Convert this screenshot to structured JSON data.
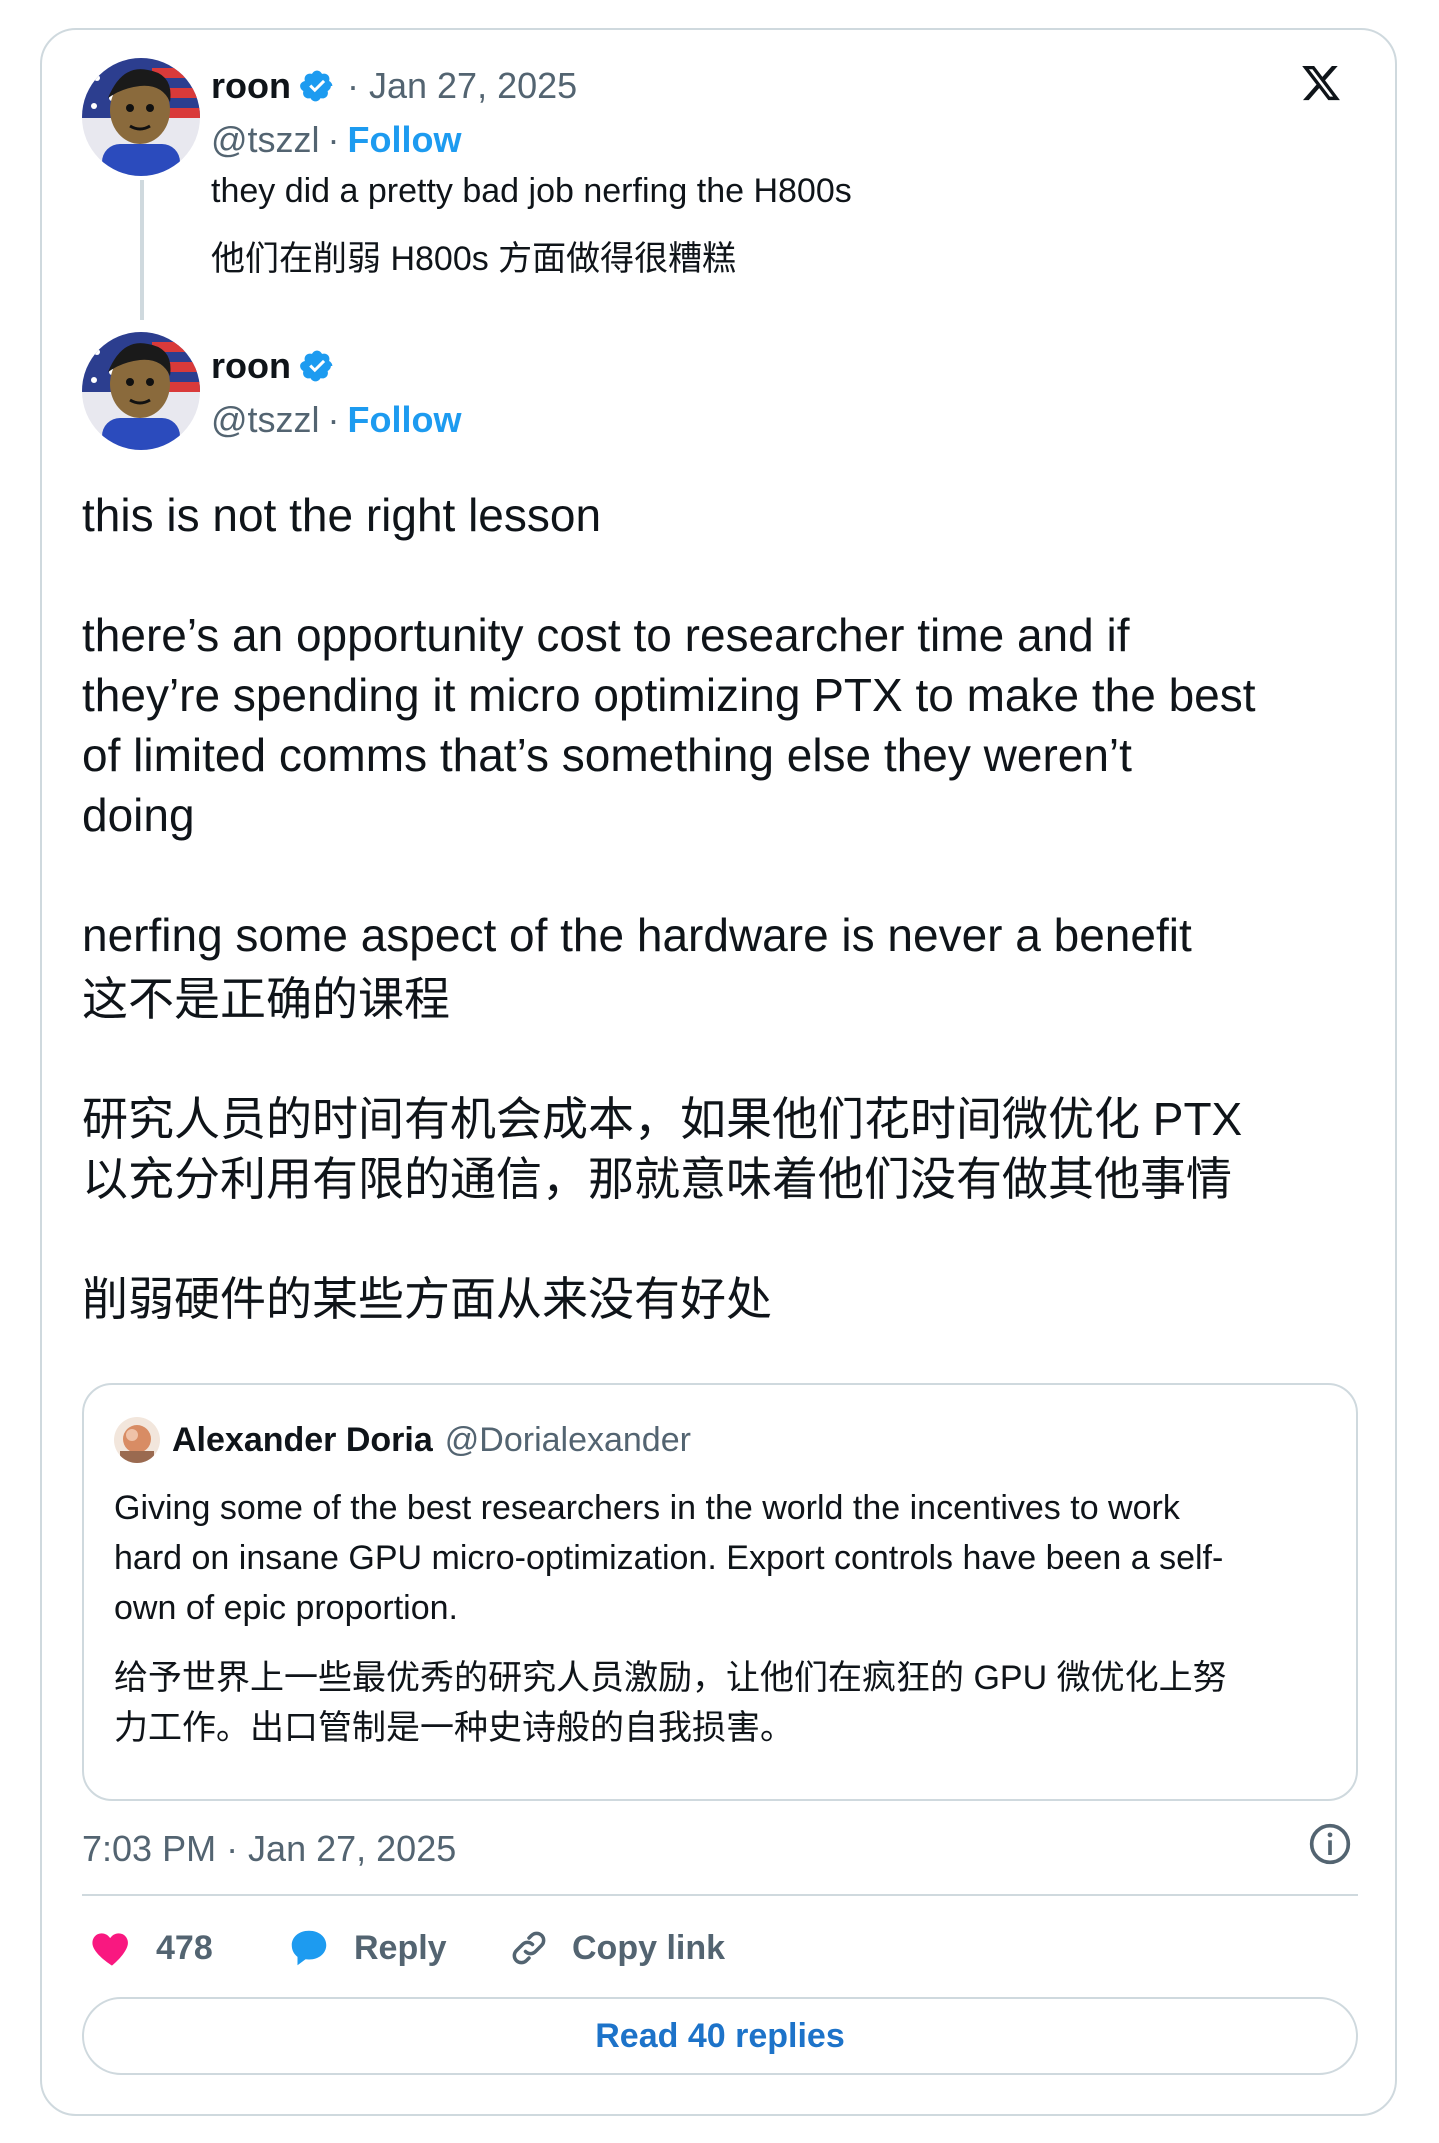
{
  "first_tweet": {
    "author_name": "roon",
    "date": "· Jan 27, 2025",
    "handle": "@tszzl",
    "dot": "·",
    "follow_label": "Follow",
    "text_en": "they did a pretty bad job nerfing the H800s",
    "text_zh": "他们在削弱 H800s 方面做得很糟糕"
  },
  "main_tweet": {
    "author_name": "roon",
    "handle": "@tszzl",
    "dot": "·",
    "follow_label": "Follow",
    "paragraphs": [
      "this is not the right lesson",
      "there’s an opportunity cost to researcher time and if\nthey’re spending it micro optimizing PTX to make the best\nof limited comms that’s something else they weren’t\ndoing",
      "nerfing some aspect of the hardware is never a benefit",
      "这不是正确的课程",
      "研究人员的时间有机会成本，如果他们花时间微优化 PTX\n以充分利用有限的通信，那就意味着他们没有做其他事情",
      "削弱硬件的某些方面从来没有好处"
    ],
    "timestamp": "7:03 PM · Jan 27, 2025"
  },
  "quoted_tweet": {
    "author_name": "Alexander Doria",
    "handle": "@Dorialexander",
    "text_en": "Giving some of the best researchers in the world the incentives to work\nhard on insane GPU micro-optimization. Export controls have been a self-\nown of epic proportion.",
    "text_zh": "给予世界上一些最优秀的研究人员激励，让他们在疯狂的 GPU 微优化上努\n力工作。出口管制是一种史诗般的自我损害。"
  },
  "actions": {
    "like_count": "478",
    "reply_label": "Reply",
    "copy_link_label": "Copy link",
    "read_replies_label": "Read 40 replies"
  },
  "icons": [
    "x-logo-icon",
    "verified-badge-icon",
    "heart-icon",
    "reply-bubble-icon",
    "link-icon",
    "info-icon"
  ],
  "colors": {
    "accent_blue": "#1d9bf0",
    "heart_pink": "#f91880",
    "muted_gray": "#536471",
    "border": "#cfd9de"
  }
}
